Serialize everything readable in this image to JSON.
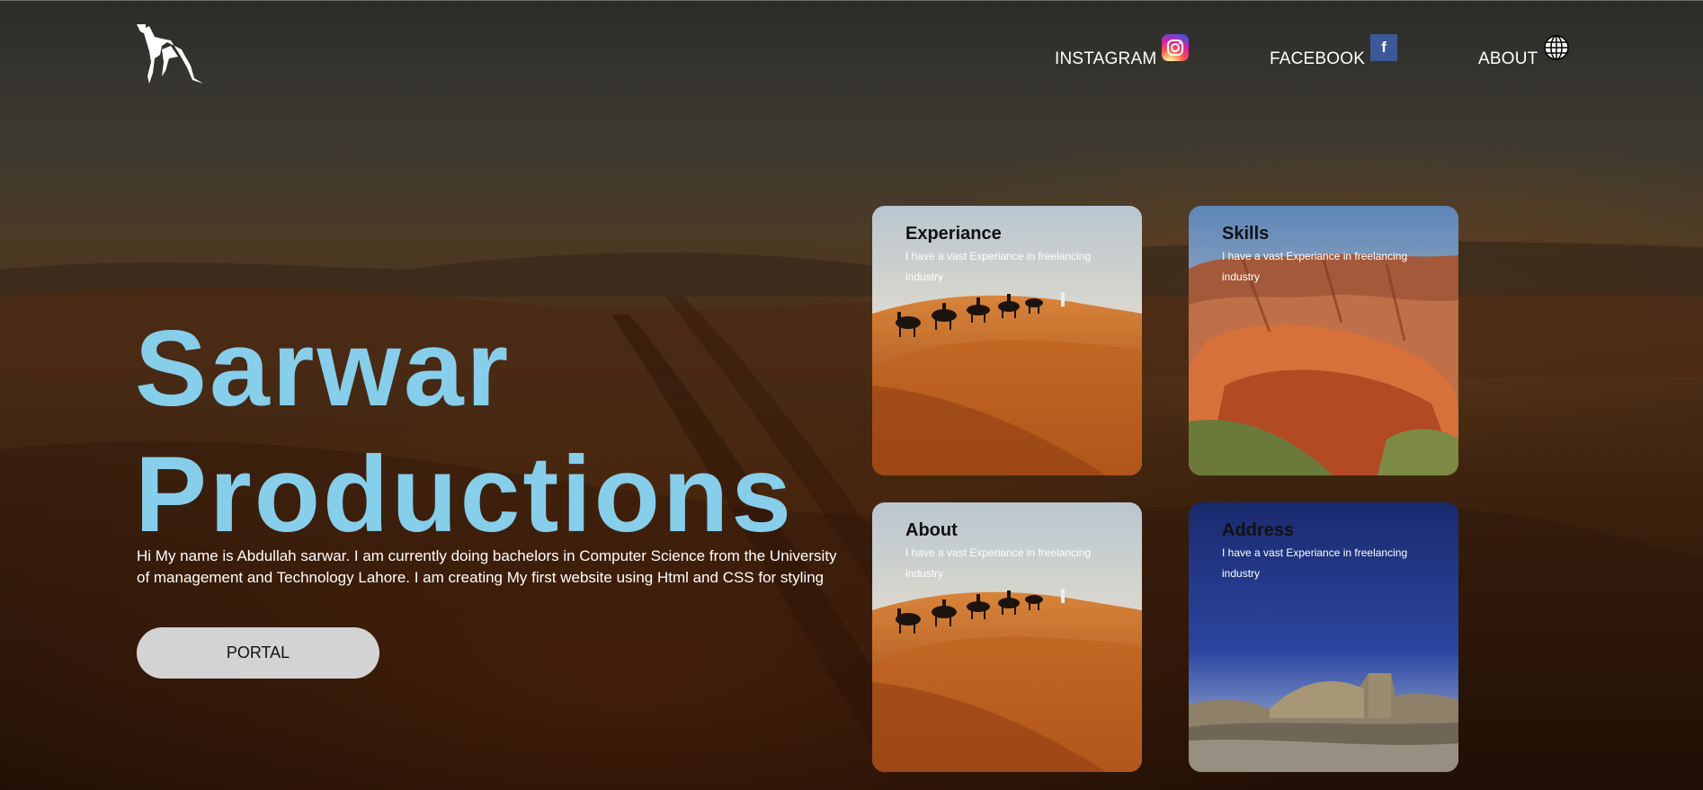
{
  "header": {
    "logo": "camel-logo",
    "nav": [
      {
        "label": "INSTAGRAM",
        "icon": "instagram-icon"
      },
      {
        "label": "FACEBOOK",
        "icon": "facebook-icon"
      },
      {
        "label": "ABOUT",
        "icon": "globe-icon"
      }
    ],
    "facebook_glyph": "f"
  },
  "hero": {
    "title_line1": "Sarwar",
    "title_line2": "Productions",
    "intro": "Hi My name is Abdullah sarwar. I am currently doing bachelors in Computer Science from the University of management and Technology Lahore. I am creating My first website using Html and CSS for styling",
    "button_label": "PORTAL"
  },
  "cards": [
    {
      "title": "Experiance",
      "desc": "I have a vast Experiance in freelancing industry",
      "image": "camel-caravan-desert"
    },
    {
      "title": "Skills",
      "desc": "I have a vast Experiance in freelancing industry",
      "image": "red-rock-canyon"
    },
    {
      "title": "About",
      "desc": "I have a vast Experiance in freelancing industry",
      "image": "camel-caravan-desert"
    },
    {
      "title": "Address",
      "desc": "I have a vast Experiance in freelancing industry",
      "image": "desert-ruins-night-sky"
    }
  ],
  "colors": {
    "title": "#87ceeb",
    "button_bg": "#d3d3d3",
    "facebook": "#3b5998"
  }
}
